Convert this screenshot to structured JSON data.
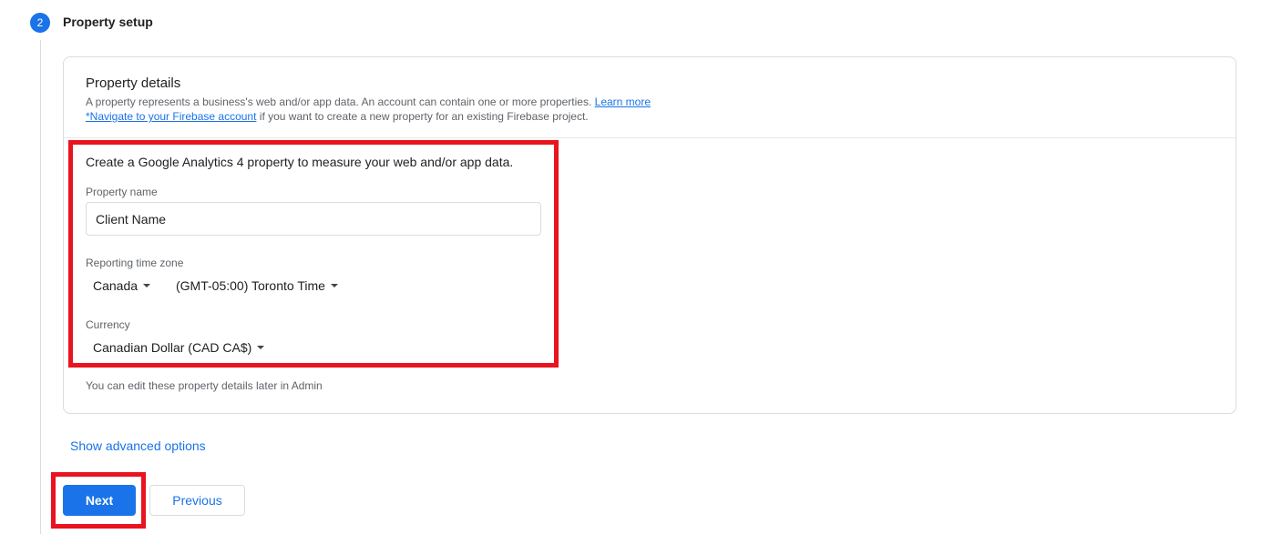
{
  "step": {
    "number": "2",
    "title": "Property setup"
  },
  "card": {
    "title": "Property details",
    "desc_line1": "A property represents a business's web and/or app data. An account can contain one or more properties.",
    "learn_more": "Learn more",
    "firebase_link": "*Navigate to your Firebase account",
    "desc_line2_rest": " if you want to create a new property for an existing Firebase project.",
    "intro": "Create a Google Analytics 4 property to measure your web and/or app data.",
    "property_name_label": "Property name",
    "property_name_value": "Client Name",
    "time_zone_label": "Reporting time zone",
    "country": "Canada",
    "time_zone": "(GMT-05:00) Toronto Time",
    "currency_label": "Currency",
    "currency": "Canadian Dollar (CAD CA$)",
    "footer_note": "You can edit these property details later in Admin"
  },
  "advanced_options": "Show advanced options",
  "buttons": {
    "next": "Next",
    "previous": "Previous"
  },
  "colors": {
    "accent": "#1a73e8",
    "highlight": "#e8141f",
    "border": "#dadce0"
  }
}
